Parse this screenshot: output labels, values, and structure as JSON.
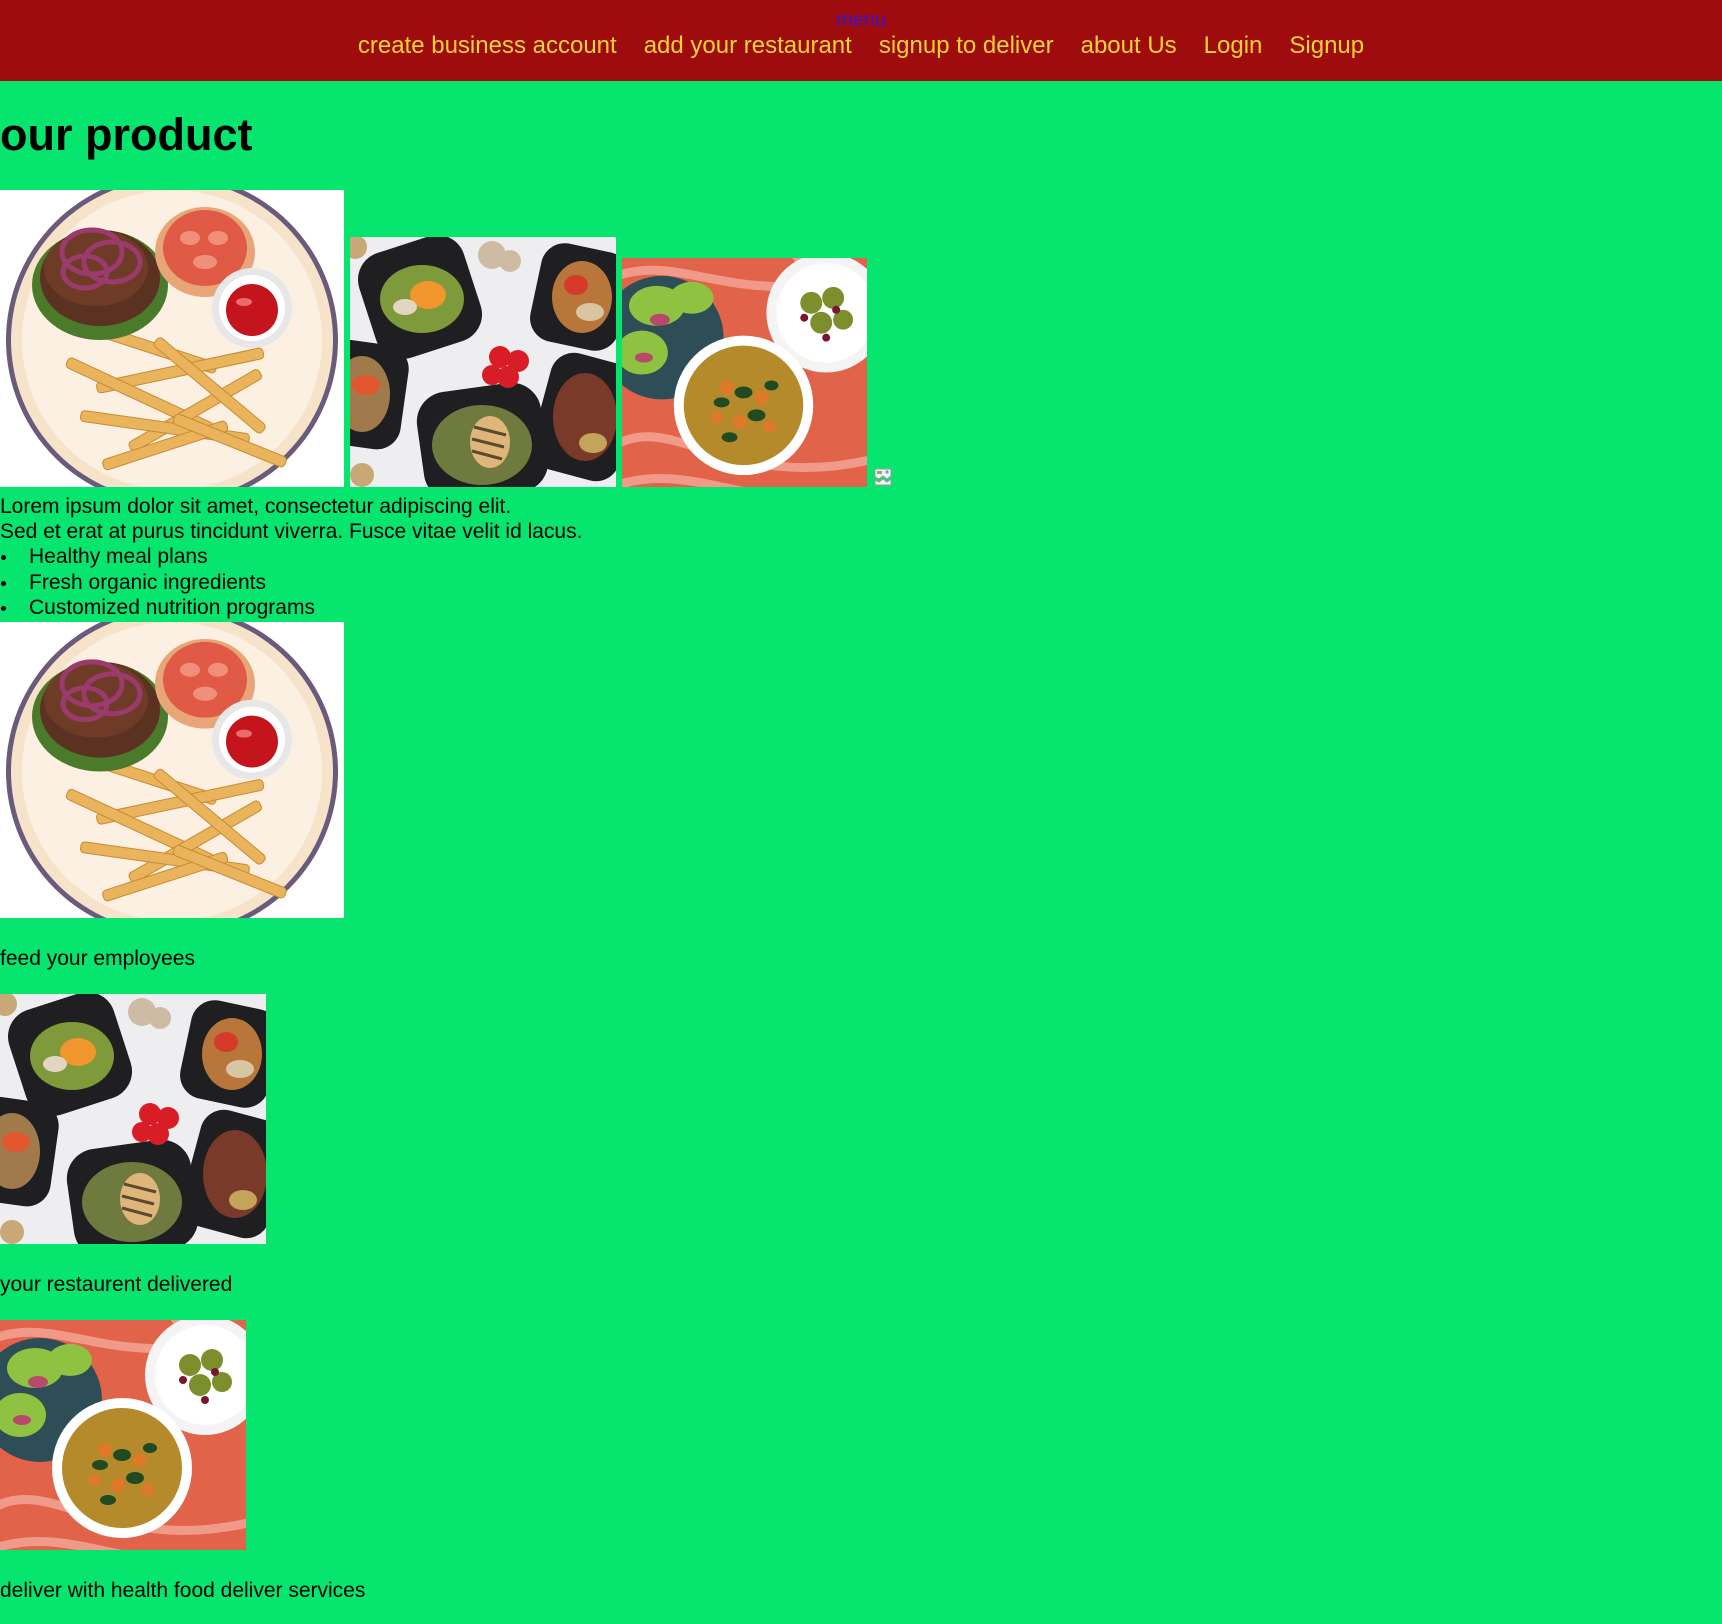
{
  "header": {
    "menu_label": "menu",
    "nav": [
      {
        "label": "create business account"
      },
      {
        "label": "add your restaurant"
      },
      {
        "label": "signup to deliver"
      },
      {
        "label": "about Us"
      },
      {
        "label": "Login"
      },
      {
        "label": "Signup"
      }
    ]
  },
  "main": {
    "title": "our product",
    "intro_line1": "Lorem ipsum dolor sit amet, consectetur adipiscing elit.",
    "intro_line2": "Sed et erat at purus tincidunt viverra. Fusce vitae velit id lacus.",
    "features": [
      "Healthy meal plans",
      "Fresh organic ingredients",
      "Customized nutrition programs"
    ],
    "caption_employees": "feed your employees",
    "caption_restaurant": "your restaurent delivered",
    "caption_health": "deliver with health food deliver services"
  },
  "colors": {
    "page_background": "#06e66f",
    "header_background": "#9e0c0d",
    "nav_link": "#f6d339",
    "menu_link": "#3d12c8"
  },
  "images": [
    {
      "name": "burger-fries-plate-image"
    },
    {
      "name": "meal-prep-containers-image"
    },
    {
      "name": "salad-bowls-image"
    }
  ]
}
